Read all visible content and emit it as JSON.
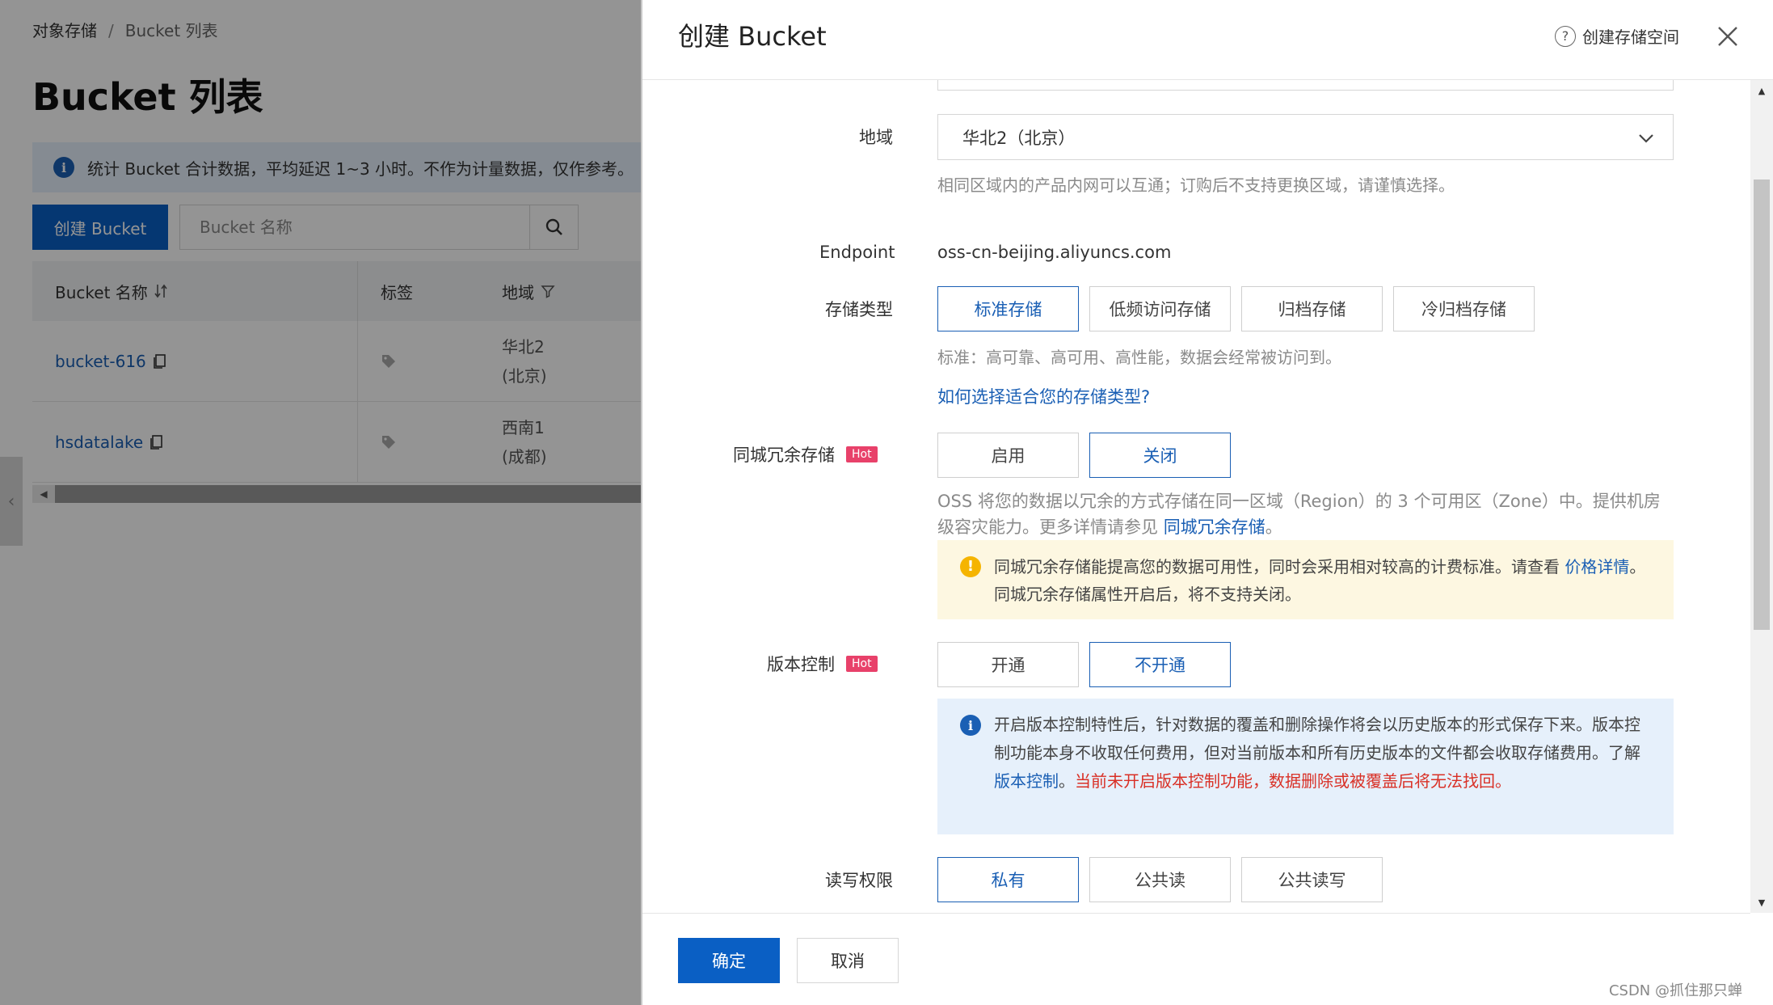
{
  "background": {
    "breadcrumb": {
      "root": "对象存储",
      "separator": "/",
      "current": "Bucket 列表"
    },
    "page_title": "Bucket 列表",
    "info_banner": "统计 Bucket 合计数据，平均延迟 1~3 小时。不作为计量数据，仅作参考。",
    "create_button": "创建 Bucket",
    "search": {
      "placeholder": "Bucket 名称"
    },
    "table": {
      "headers": [
        "Bucket 名称",
        "标签",
        "地域"
      ],
      "rows": [
        {
          "name": "bucket-616",
          "region_line1": "华北2",
          "region_line2": "(北京)"
        },
        {
          "name": "hsdatalake",
          "region_line1": "西南1",
          "region_line2": "(成都)"
        }
      ]
    }
  },
  "drawer": {
    "title": "创建 Bucket",
    "help_link": "创建存储空间",
    "region": {
      "label": "地域",
      "value": "华北2（北京）",
      "help": "相同区域内的产品内网可以互通；订购后不支持更换区域，请谨慎选择。"
    },
    "endpoint": {
      "label": "Endpoint",
      "value": "oss-cn-beijing.aliyuncs.com"
    },
    "storage_class": {
      "label": "存储类型",
      "options": [
        "标准存储",
        "低频访问存储",
        "归档存储",
        "冷归档存储"
      ],
      "selected": "标准存储",
      "help": "标准：高可靠、高可用、高性能，数据会经常被访问到。",
      "link": "如何选择适合您的存储类型?"
    },
    "redundancy": {
      "label": "同城冗余存储",
      "badge": "Hot",
      "options": [
        "启用",
        "关闭"
      ],
      "selected": "关闭",
      "note_prefix": "OSS 将您的数据以冗余的方式存储在同一区域（Region）的 3 个可用区（Zone）中。提供机房级容灾能力。更多详情请参见 ",
      "note_link": "同城冗余存储",
      "note_suffix": "。",
      "warning_prefix": "同城冗余存储能提高您的数据可用性，同时会采用相对较高的计费标准。请查看 ",
      "warning_link": "价格详情",
      "warning_suffix": "。同城冗余存储属性开启后，将不支持关闭。"
    },
    "versioning": {
      "label": "版本控制",
      "badge": "Hot",
      "options": [
        "开通",
        "不开通"
      ],
      "selected": "不开通",
      "info_prefix": "开启版本控制特性后，针对数据的覆盖和删除操作将会以历史版本的形式保存下来。版本控制功能本身不收取任何费用，但对当前版本和所有历史版本的文件都会收取存储费用。了解 ",
      "info_link": "版本控制",
      "info_mid": "。",
      "info_warning": "当前未开启版本控制功能，数据删除或被覆盖后将无法找回。"
    },
    "acl": {
      "label": "读写权限",
      "options": [
        "私有",
        "公共读",
        "公共读写"
      ],
      "selected": "私有"
    },
    "footer": {
      "ok": "确定",
      "cancel": "取消"
    }
  },
  "watermark": "CSDN @抓住那只蝉",
  "colors": {
    "primary": "#0a5fc4",
    "link": "#1a5fb4",
    "hot_badge": "#e8416a",
    "warning_bg": "#fdf7e1",
    "info_bg": "#e6f0fb",
    "danger": "#d93026"
  }
}
